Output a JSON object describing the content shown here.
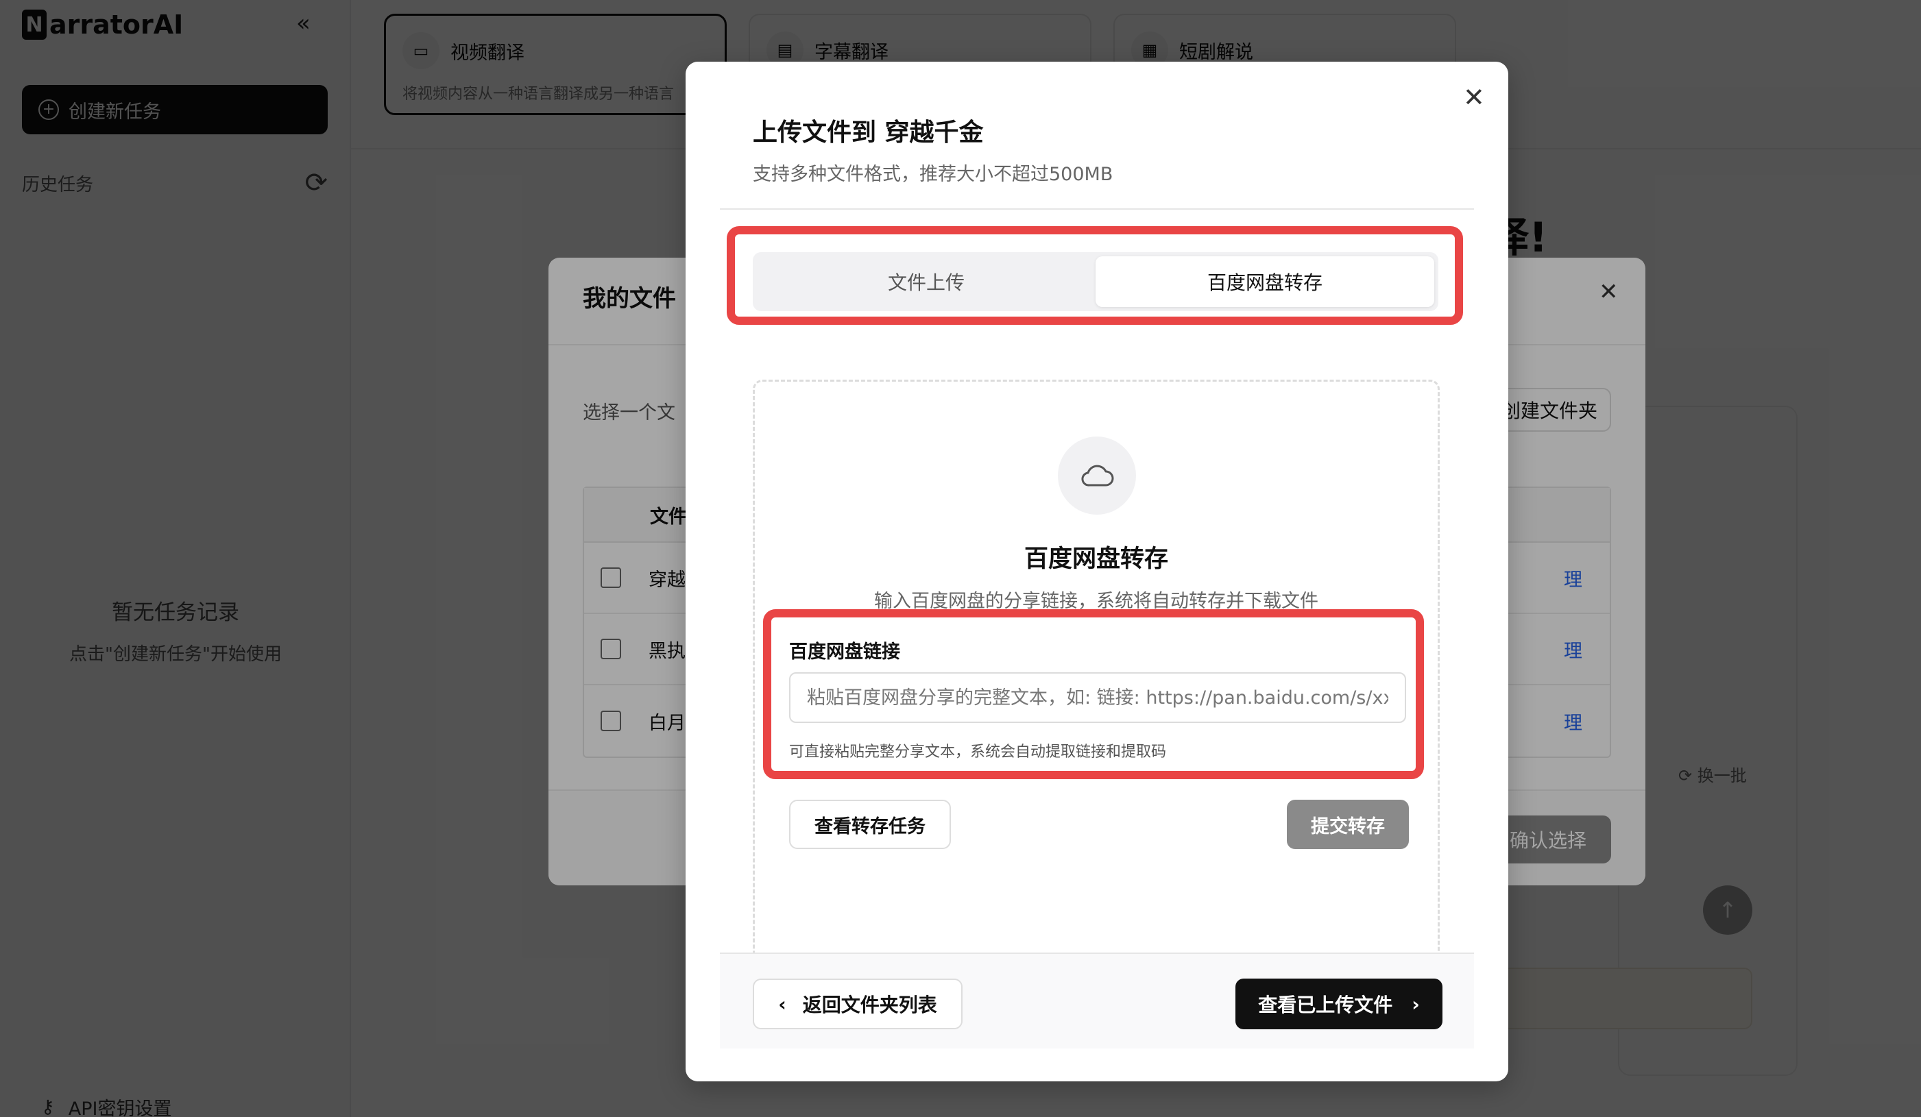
{
  "app": {
    "logo_letter": "N",
    "logo_text": "arratorAI",
    "new_task": "创建新任务",
    "history_title": "历史任务",
    "empty_title": "暂无任务记录",
    "empty_hint": "点击\"创建新任务\"开始使用",
    "api_settings": "API密钥设置"
  },
  "top_cards": [
    {
      "title": "视频翻译",
      "desc": "将视频内容从一种语言翻译成另一种语言"
    },
    {
      "title": "字幕翻译",
      "desc": ""
    },
    {
      "title": "短剧解说",
      "desc": ""
    }
  ],
  "hero_title": "翻译!",
  "refresh_batch": "换一批",
  "files_dialog": {
    "title": "我的文件",
    "subtitle": "选择一个文",
    "new_folder": "创建文件夹",
    "column_file": "文件",
    "rows": [
      {
        "name": "穿越",
        "action": "理"
      },
      {
        "name": "黑执",
        "action": "理"
      },
      {
        "name": "白月",
        "action": "理"
      }
    ],
    "confirm": "确认选择"
  },
  "modal": {
    "title": "上传文件到 穿越千金",
    "subtitle": "支持多种文件格式，推荐大小不超过500MB",
    "tabs": [
      {
        "label": "文件上传",
        "active": false
      },
      {
        "label": "百度网盘转存",
        "active": true
      }
    ],
    "panel_title": "百度网盘转存",
    "panel_desc": "输入百度网盘的分享链接，系统将自动转存并下载文件",
    "field_label": "百度网盘链接",
    "field_placeholder": "粘贴百度网盘分享的完整文本，如: 链接: https://pan.baidu.com/s/xxx",
    "field_value": "",
    "field_hint": "可直接粘贴完整分享文本，系统会自动提取链接和提取码",
    "view_tasks": "查看转存任务",
    "submit": "提交转存",
    "back": "返回文件夹列表",
    "view_uploaded": "查看已上传文件"
  },
  "colors": {
    "highlight": "#e94545",
    "primary": "#111111",
    "disabled": "#8a8a8a",
    "link": "#2563eb"
  }
}
